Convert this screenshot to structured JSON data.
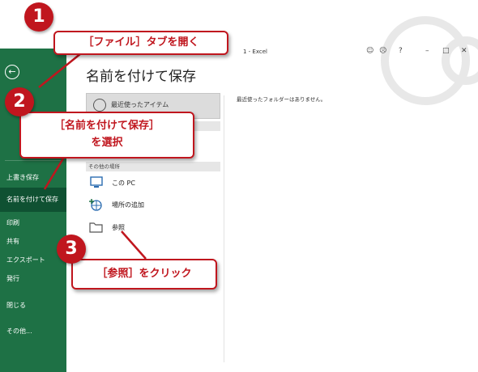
{
  "titlebar": {
    "title": "1 - Excel"
  },
  "sidebar": {
    "back_icon": "back-arrow-icon",
    "items": [
      {
        "label": "上書き保存"
      },
      {
        "label": "名前を付けて保存"
      },
      {
        "label": "印刷"
      },
      {
        "label": "共有"
      },
      {
        "label": "エクスポート"
      },
      {
        "label": "発行"
      },
      {
        "label": "閉じる"
      },
      {
        "label": "その他..."
      }
    ]
  },
  "main": {
    "title": "名前を付けて保存",
    "recent": {
      "label": "最近使ったアイテム"
    },
    "other_locations_header": "その他の場所",
    "locations": [
      {
        "label": "この PC",
        "icon": "pc-icon"
      },
      {
        "label": "場所の追加",
        "icon": "add-location-icon"
      },
      {
        "label": "参照",
        "icon": "folder-icon"
      }
    ],
    "empty_message": "最近使ったフォルダーはありません。"
  },
  "callouts": [
    {
      "number": "1",
      "text": "［ファイル］タブを開く"
    },
    {
      "number": "2",
      "line1": "［名前を付けて保存］",
      "line2": "を選択"
    },
    {
      "number": "3",
      "text": "［参照］をクリック"
    }
  ],
  "colors": {
    "accent": "#1e7145",
    "callout": "#c0161e"
  }
}
